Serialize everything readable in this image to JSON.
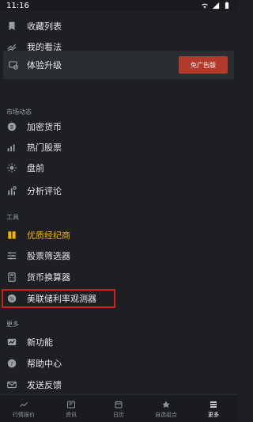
{
  "status_bar": {
    "time": "11:16"
  },
  "menu": {
    "favorites": "收藏列表",
    "my_views": "我的看法"
  },
  "upgrade": {
    "label": "体验升级",
    "button": "免广告版"
  },
  "sections": {
    "market": {
      "title": "市场动态",
      "items": [
        "加密货币",
        "热门股票",
        "盘前",
        "分析评论"
      ]
    },
    "tools": {
      "title": "工具",
      "items": [
        "优质经纪商",
        "股票筛选器",
        "货币换算器",
        "美联储利率观测器"
      ]
    },
    "more": {
      "title": "更多",
      "items": [
        "新功能",
        "帮助中心",
        "发送反馈"
      ]
    }
  },
  "bottom_nav": {
    "items": [
      "行情报价",
      "资讯",
      "日历",
      "自选组合",
      "更多"
    ],
    "active_index": 4
  },
  "colors": {
    "background": "#1d1f22",
    "accent_gold": "#f0b400",
    "upgrade_button": "#b23a2b",
    "highlight": "#d21f1f"
  }
}
